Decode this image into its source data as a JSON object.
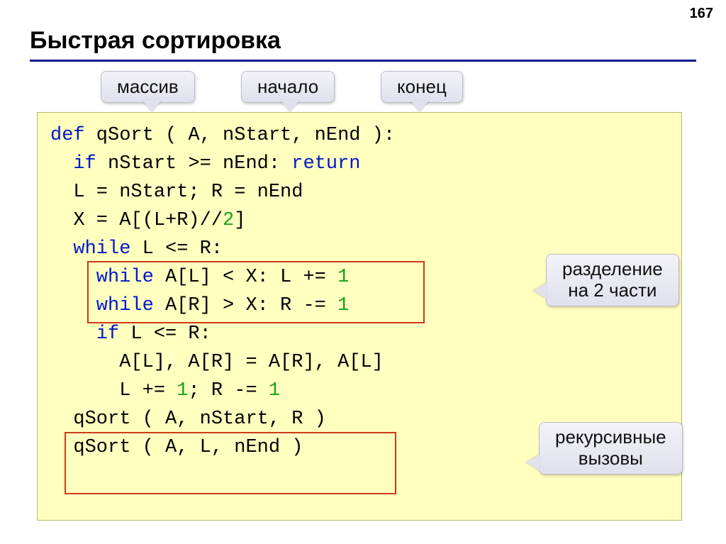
{
  "page_number": "167",
  "title": "Быстрая сортировка",
  "callouts": {
    "array": "массив",
    "start": "начало",
    "end": "конец",
    "split": "разделение\nна 2 части",
    "recursive": "рекурсивные\nвызовы"
  },
  "code": {
    "l1a": "def",
    "l1b": " qSort ( A, nStart, nEnd ):",
    "l2a": "  if",
    "l2b": " nStart >= nEnd: ",
    "l2c": "return",
    "l3": "  L = nStart; R = nEnd",
    "l4a": "  X = A[(L+R)//",
    "l4b": "2",
    "l4c": "]",
    "l5a": "  while",
    "l5b": " L <= R:",
    "l6a": "    while",
    "l6b": " A[L] < X: L += ",
    "l6c": "1",
    "l7a": "    while",
    "l7b": " A[R] > X: R -= ",
    "l7c": "1",
    "l8a": "    if",
    "l8b": " L <= R:",
    "l9": "      A[L], A[R] = A[R], A[L]",
    "l10a": "      L += ",
    "l10b": "1",
    "l10c": "; R -= ",
    "l10d": "1",
    "l11": "  qSort ( A, nStart, R )",
    "l12": "  qSort ( A, L, nEnd )"
  }
}
